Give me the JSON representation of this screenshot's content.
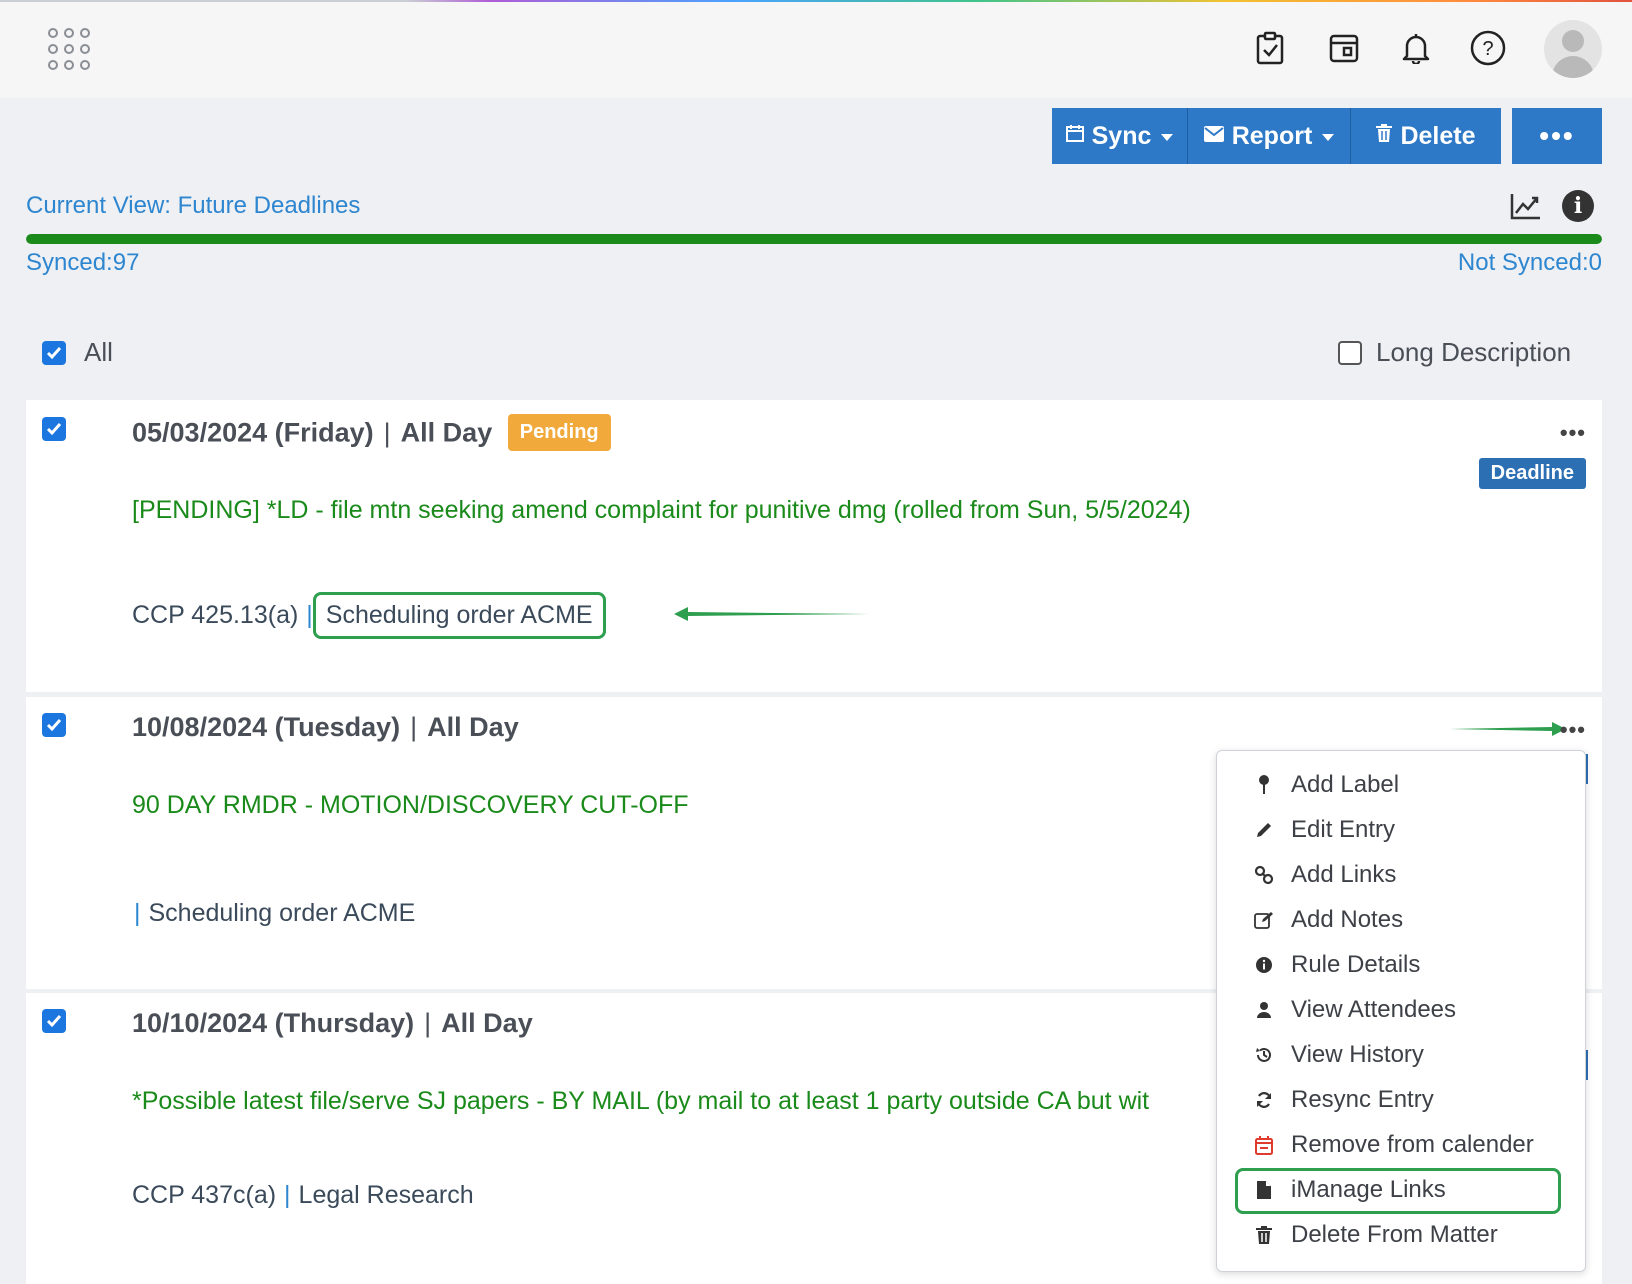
{
  "header": {
    "icons": [
      "apps-grid-icon",
      "clipboard-check-icon",
      "calendar-box-icon",
      "bell-icon",
      "help-icon",
      "user-avatar-icon"
    ]
  },
  "toolbar": {
    "sync_label": "Sync",
    "report_label": "Report",
    "delete_label": "Delete",
    "more_label": "•••"
  },
  "view": {
    "current_view": "Current View: Future Deadlines",
    "synced": "Synced:97",
    "not_synced": "Not Synced:0",
    "sync_progress": 1.0
  },
  "filters": {
    "all_label": "All",
    "all_checked": true,
    "long_description_label": "Long Description",
    "long_description_checked": false
  },
  "entries": [
    {
      "date": "05/03/2024 (Friday)",
      "time": "All Day",
      "status_badge": "Pending",
      "type_badge": "Deadline",
      "title": "[PENDING] *LD - file mtn seeking amend complaint for punitive dmg (rolled from Sun, 5/5/2024)",
      "rule": "CCP 425.13(a)",
      "matter": "Scheduling order ACME",
      "checked": true
    },
    {
      "date": "10/08/2024 (Tuesday)",
      "time": "All Day",
      "title": "90 DAY RMDR - MOTION/DISCOVERY CUT-OFF",
      "rule": "",
      "matter": "Scheduling order ACME",
      "checked": true
    },
    {
      "date": "10/10/2024 (Thursday)",
      "time": "All Day",
      "title": "*Possible latest file/serve SJ papers - BY MAIL (by mail to at least 1 party outside CA but wit",
      "rule": "CCP 437c(a)",
      "matter": "Legal Research",
      "checked": true
    }
  ],
  "context_menu": {
    "items": [
      {
        "label": "Add Label",
        "icon": "pin-icon"
      },
      {
        "label": "Edit Entry",
        "icon": "pencil-icon"
      },
      {
        "label": "Add Links",
        "icon": "link-icon"
      },
      {
        "label": "Add Notes",
        "icon": "edit-note-icon"
      },
      {
        "label": "Rule Details",
        "icon": "info-circle-icon"
      },
      {
        "label": "View Attendees",
        "icon": "user-icon"
      },
      {
        "label": "View History",
        "icon": "history-icon"
      },
      {
        "label": "Resync Entry",
        "icon": "refresh-icon"
      },
      {
        "label": "Remove from calender",
        "icon": "calendar-remove-icon"
      },
      {
        "label": "iManage Links",
        "icon": "file-icon"
      },
      {
        "label": "Delete From Matter",
        "icon": "trash-icon"
      }
    ],
    "highlighted_item": "iManage Links"
  },
  "colors": {
    "primary": "#2d79c7",
    "link": "#2d86cf",
    "title_green": "#1a8a1a",
    "pending": "#f2a93b",
    "deadline": "#2d6fb3",
    "highlight": "#2e9e4f"
  }
}
